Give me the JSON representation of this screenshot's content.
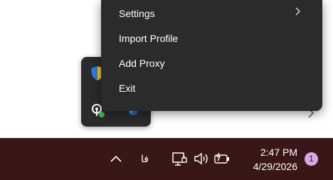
{
  "background": {
    "chevron_icon": "chevron-right-icon"
  },
  "context_menu": {
    "items": [
      {
        "label": "Settings",
        "has_submenu": true
      },
      {
        "label": "Import Profile"
      },
      {
        "label": "Add Proxy"
      },
      {
        "label": "Exit"
      }
    ]
  },
  "tray_flyout": {
    "icons": [
      "shield-icon",
      "network-status-icon",
      "blue-app-icon"
    ]
  },
  "taskbar": {
    "overflow_icon": "chevron-up-icon",
    "input_indicator": "فا",
    "clock": {
      "time": "2:47 PM",
      "date": "4/29/2026"
    },
    "notification_count": "1",
    "colors": {
      "taskbar_bg": "#3a1717",
      "badge_bg": "#d9a7e8"
    }
  }
}
